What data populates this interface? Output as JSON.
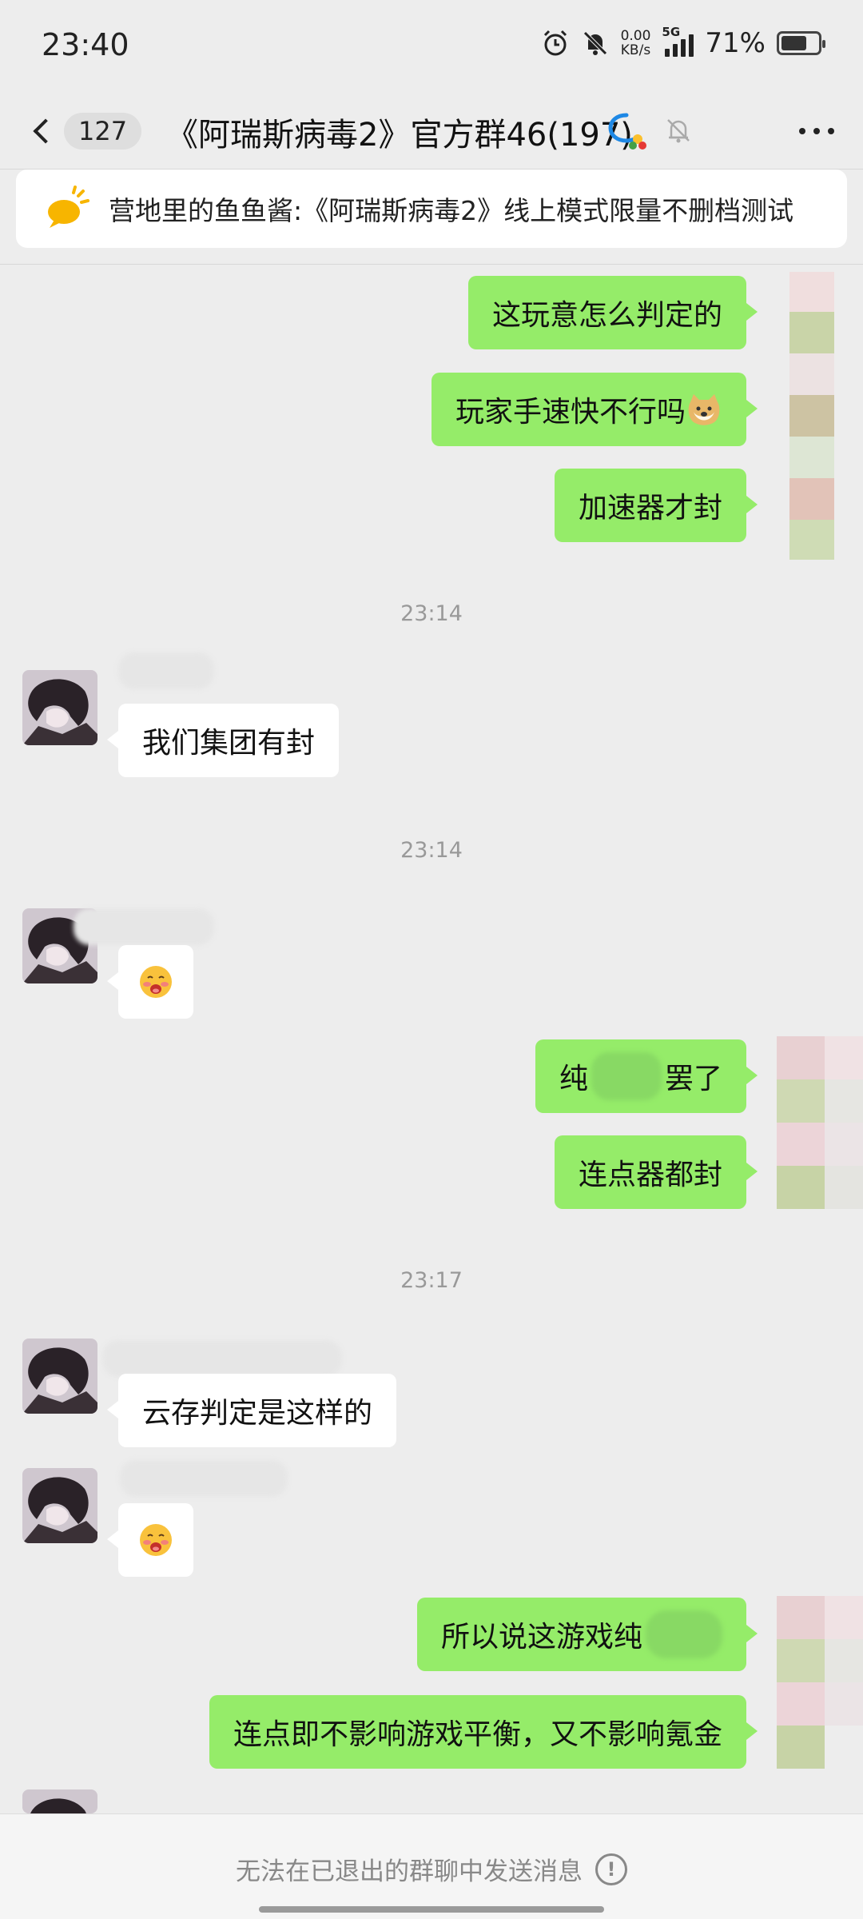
{
  "status_bar": {
    "time": "23:40",
    "net_speed_value": "0.00",
    "net_speed_unit": "KB/s",
    "network": "5G",
    "battery_percent": "71%",
    "battery_level": 0.71
  },
  "header": {
    "unread_count": "127",
    "title": "《阿瑞斯病毒2》官方群46(197)"
  },
  "announcement": {
    "text": "营地里的鱼鱼酱:《阿瑞斯病毒2》线上模式限量不删档测试"
  },
  "messages": [
    {
      "type": "out",
      "text": "这玩意怎么判定的"
    },
    {
      "type": "out",
      "text": "玩家手速快不行吗",
      "emoji": "doge-icon"
    },
    {
      "type": "out",
      "text": "加速器才封"
    },
    {
      "type": "time",
      "text": "23:14"
    },
    {
      "type": "in",
      "text": "我们集团有封"
    },
    {
      "type": "time",
      "text": "23:14"
    },
    {
      "type": "in",
      "emoji": "blushing-face-icon"
    },
    {
      "type": "out",
      "text_left": "纯",
      "text_right": "罢了"
    },
    {
      "type": "out",
      "text": "连点器都封"
    },
    {
      "type": "time",
      "text": "23:17"
    },
    {
      "type": "in",
      "text": "云存判定是这样的"
    },
    {
      "type": "in",
      "emoji": "blushing-face-icon"
    },
    {
      "type": "out",
      "text": "所以说这游戏纯"
    },
    {
      "type": "out",
      "text": "连点即不影响游戏平衡，又不影响氪金"
    }
  ],
  "bottom": {
    "notice": "无法在已退出的群聊中发送消息",
    "info_glyph": "!"
  },
  "colors": {
    "background": "#ededed",
    "bubble_out": "#95ec69",
    "bubble_in": "#ffffff",
    "announce_icon": "#f7b500"
  }
}
